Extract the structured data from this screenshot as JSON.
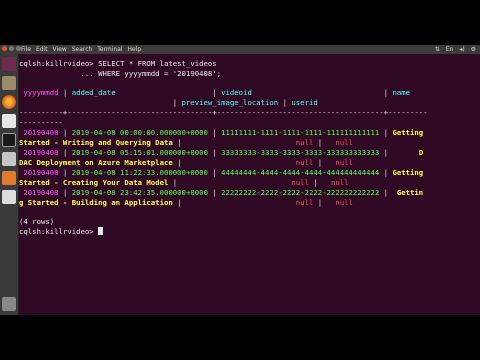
{
  "menubar": {
    "items": [
      "File",
      "Edit",
      "View",
      "Search",
      "Terminal",
      "Help"
    ],
    "status": [
      "⇅",
      "En",
      "◂)",
      "⚙"
    ]
  },
  "launcher": {
    "icons": [
      "ubuntu-icon",
      "files-icon",
      "firefox-icon",
      "writer-icon",
      "terminal-icon",
      "settings-icon",
      "software-icon",
      "amazon-icon",
      "trash-icon"
    ]
  },
  "terminal": {
    "prompt1": "cqlsh:killrvideo> SELECT * FROM latest_videos",
    "prompt2": "              ... WHERE yyyymmdd = '20190408';",
    "header1": {
      "col1": " yyyymmdd",
      "col2": "added_date",
      "col3": "videoid",
      "col4": "name"
    },
    "header2": {
      "col5": "preview_image_location",
      "col6": "userid"
    },
    "divider": "----------+---------------------------------+--------------------------------------+---------",
    "divider2": "----------",
    "rows": [
      {
        "yyyymmdd": " 20190408",
        "added_date": "2019-04-08 00:00:00.000000+0000",
        "videoid": "11111111-1111-1111-1111-111111111111",
        "name_a": "Getting",
        "name_b": "Started - Writing and Querying Data",
        "preview": "null",
        "userid": "null"
      },
      {
        "yyyymmdd": " 20190408",
        "added_date": "2019-04-08 05:15:01.000000+0000",
        "videoid": "33333333-3333-3333-3333-333333333333",
        "name_a": "D",
        "name_b": "DAC Deployment on Azure Marketplace",
        "preview": "null",
        "userid": "null"
      },
      {
        "yyyymmdd": " 20190408",
        "added_date": "2019-04-08 11:22:33.000000+0000",
        "videoid": "44444444-4444-4444-4444-444444444444",
        "name_a": "Getting",
        "name_b": "Started - Creating Your Data Model",
        "preview": "null",
        "userid": "null"
      },
      {
        "yyyymmdd": " 20190408",
        "added_date": "2019-04-08 23:42:35.000000+0000",
        "videoid": "22222222-2222-2222-2222-222222222222",
        "name_a": "Gettin",
        "name_b": "g Started - Building an Application",
        "preview": "null",
        "userid": "null"
      }
    ],
    "rowcount": "(4 rows)",
    "prompt3": "cqlsh:killrvideo> "
  }
}
